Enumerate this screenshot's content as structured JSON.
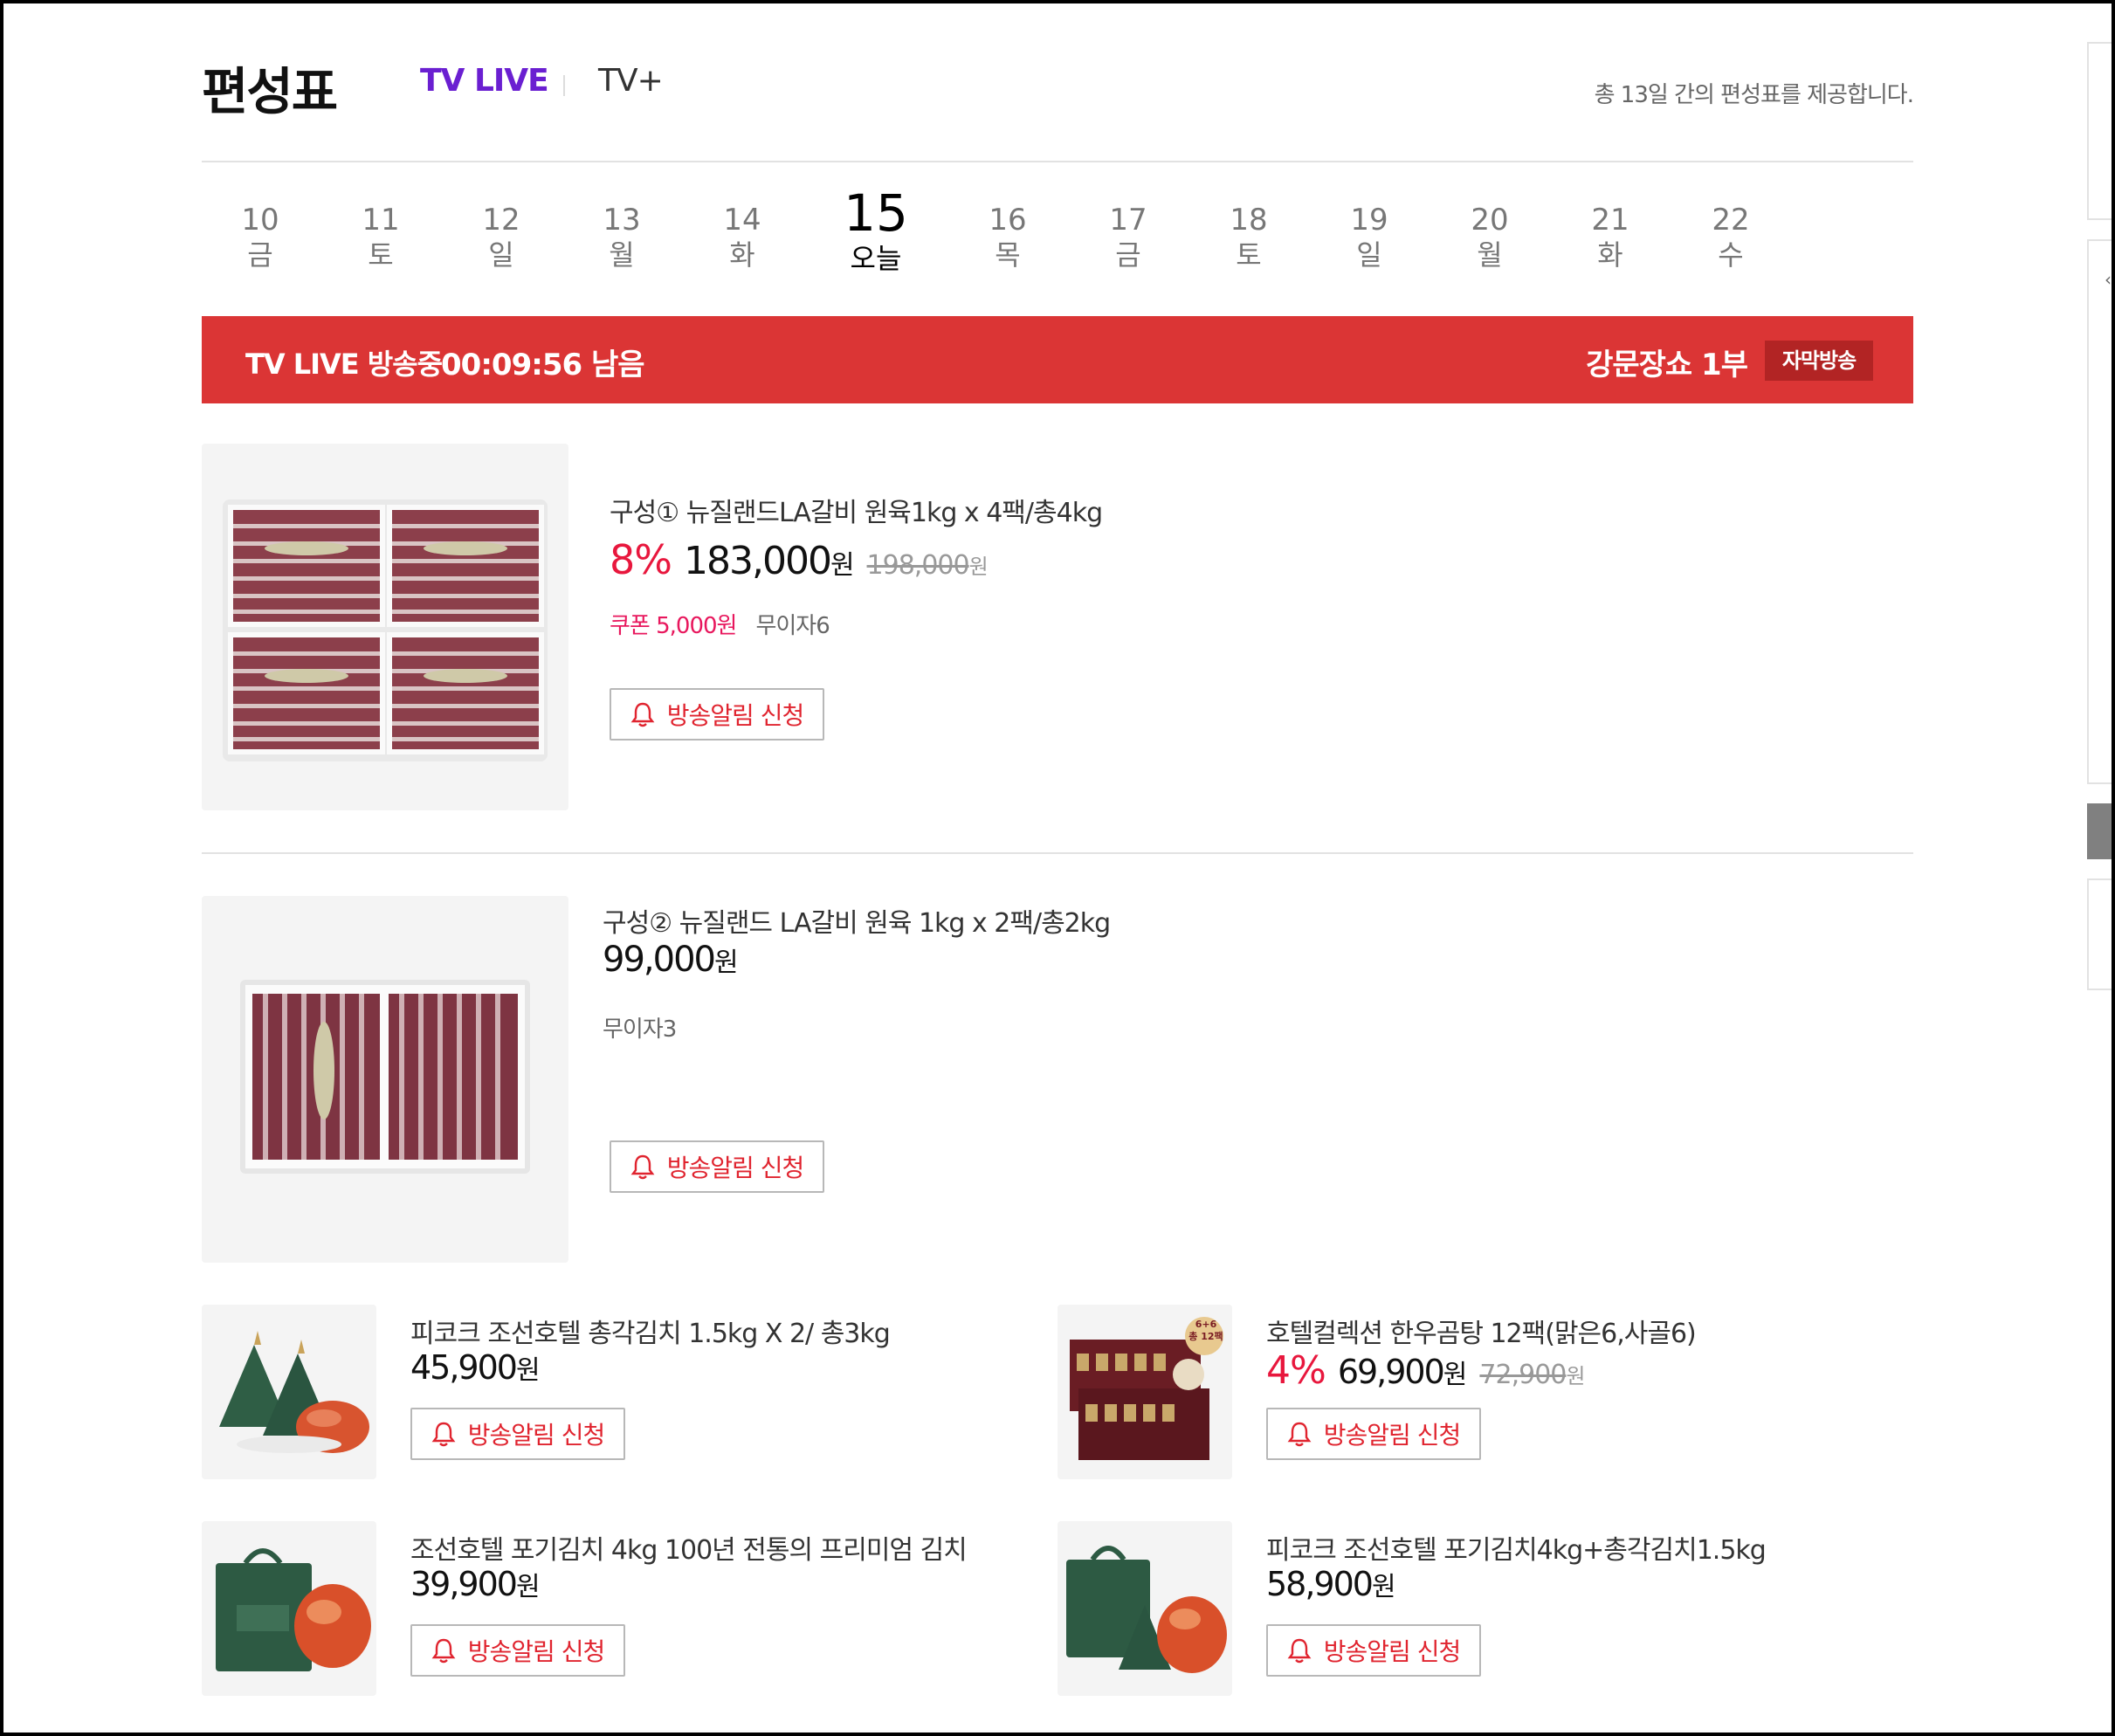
{
  "header": {
    "title": "편성표",
    "tab_live": "TV LIVE",
    "tab_plus": "TV+",
    "note": "총 13일 간의 편성표를 제공합니다."
  },
  "dates": [
    {
      "day": "10",
      "weekday": "금"
    },
    {
      "day": "11",
      "weekday": "토"
    },
    {
      "day": "12",
      "weekday": "일"
    },
    {
      "day": "13",
      "weekday": "월"
    },
    {
      "day": "14",
      "weekday": "화"
    },
    {
      "day": "15",
      "weekday": "오늘"
    },
    {
      "day": "16",
      "weekday": "목"
    },
    {
      "day": "17",
      "weekday": "금"
    },
    {
      "day": "18",
      "weekday": "토"
    },
    {
      "day": "19",
      "weekday": "일"
    },
    {
      "day": "20",
      "weekday": "월"
    },
    {
      "day": "21",
      "weekday": "화"
    },
    {
      "day": "22",
      "weekday": "수"
    }
  ],
  "selected_date": "15",
  "live": {
    "status": "TV LIVE 방송중",
    "remaining": "00:09:56 남음",
    "show": "강문장쇼 1부",
    "badge": "자막방송",
    "color": "#db3535"
  },
  "alarm_label": "방송알림 신청",
  "won": "원",
  "products": [
    {
      "name": "구성① 뉴질랜드LA갈비 원육1kg x 4팩/총4kg",
      "discount": "8%",
      "price": "183,000",
      "original_price": "198,000",
      "coupon": "쿠폰 5,000원",
      "installment": "무이자6"
    },
    {
      "name": "구성② 뉴질랜드 LA갈비 원육 1kg x 2팩/총2kg",
      "price": "99,000",
      "installment": "무이자3"
    },
    {
      "name": "피코크 조선호텔 총각김치 1.5kg X 2/ 총3kg",
      "price": "45,900"
    },
    {
      "name": "호텔컬렉션 한우곰탕 12팩(맑은6,사골6)",
      "discount": "4%",
      "price": "69,900",
      "original_price": "72,900",
      "image_badge_top": "6+6",
      "image_badge_bottom": "총 12팩"
    },
    {
      "name": "조선호텔 포기김치 4kg 100년 전통의 프리미엄 김치",
      "price": "39,900"
    },
    {
      "name": "피코크 조선호텔 포기김치4kg+총각김치1.5kg",
      "price": "58,900"
    }
  ],
  "colors": {
    "accent_purple": "#6a1fd1",
    "discount_red": "#e8173d",
    "coupon_pink": "#e8175d"
  }
}
